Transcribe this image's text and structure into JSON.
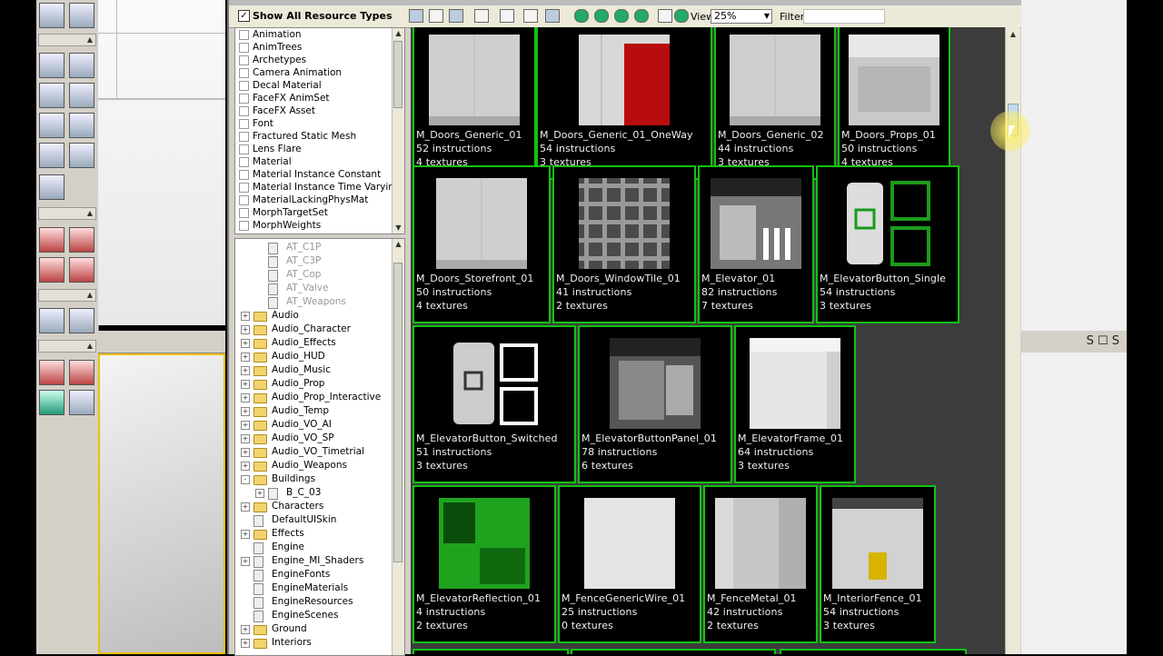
{
  "browser": {
    "show_all_label": "Show All Resource Types",
    "show_all_checked": true,
    "view_label": "View",
    "view_value": "25%",
    "filter_label": "Filter",
    "filter_value": ""
  },
  "resource_types": [
    "Animation",
    "AnimTrees",
    "Archetypes",
    "Camera Animation",
    "Decal Material",
    "FaceFX AnimSet",
    "FaceFX Asset",
    "Font",
    "Fractured Static Mesh",
    "Lens Flare",
    "Material",
    "Material Instance Constant",
    "Material Instance Time Varying",
    "MaterialLackingPhysMat",
    "MorphTargetSet",
    "MorphWeights"
  ],
  "package_tree": [
    {
      "label": "AT_C1P",
      "kind": "pkg",
      "indent": 1,
      "grey": true
    },
    {
      "label": "AT_C3P",
      "kind": "pkg",
      "indent": 1,
      "grey": true
    },
    {
      "label": "AT_Cop",
      "kind": "pkg",
      "indent": 1,
      "grey": true
    },
    {
      "label": "AT_Valve",
      "kind": "pkg",
      "indent": 1,
      "grey": true
    },
    {
      "label": "AT_Weapons",
      "kind": "pkg",
      "indent": 1,
      "grey": true
    },
    {
      "label": "Audio",
      "kind": "folder",
      "indent": 0,
      "toggle": "+"
    },
    {
      "label": "Audio_Character",
      "kind": "folder",
      "indent": 0,
      "toggle": "+"
    },
    {
      "label": "Audio_Effects",
      "kind": "folder",
      "indent": 0,
      "toggle": "+"
    },
    {
      "label": "Audio_HUD",
      "kind": "folder",
      "indent": 0,
      "toggle": "+"
    },
    {
      "label": "Audio_Music",
      "kind": "folder",
      "indent": 0,
      "toggle": "+"
    },
    {
      "label": "Audio_Prop",
      "kind": "folder",
      "indent": 0,
      "toggle": "+"
    },
    {
      "label": "Audio_Prop_Interactive",
      "kind": "folder",
      "indent": 0,
      "toggle": "+"
    },
    {
      "label": "Audio_Temp",
      "kind": "folder",
      "indent": 0,
      "toggle": "+"
    },
    {
      "label": "Audio_VO_AI",
      "kind": "folder",
      "indent": 0,
      "toggle": "+"
    },
    {
      "label": "Audio_VO_SP",
      "kind": "folder",
      "indent": 0,
      "toggle": "+"
    },
    {
      "label": "Audio_VO_Timetrial",
      "kind": "folder",
      "indent": 0,
      "toggle": "+"
    },
    {
      "label": "Audio_Weapons",
      "kind": "folder",
      "indent": 0,
      "toggle": "+"
    },
    {
      "label": "Buildings",
      "kind": "folder",
      "indent": 0,
      "toggle": "-"
    },
    {
      "label": "B_C_03",
      "kind": "pkg",
      "indent": 1,
      "toggle": "+"
    },
    {
      "label": "Characters",
      "kind": "folder",
      "indent": 0,
      "toggle": "+"
    },
    {
      "label": "DefaultUISkin",
      "kind": "pkg",
      "indent": 0
    },
    {
      "label": "Effects",
      "kind": "folder",
      "indent": 0,
      "toggle": "+"
    },
    {
      "label": "Engine",
      "kind": "pkg",
      "indent": 0
    },
    {
      "label": "Engine_MI_Shaders",
      "kind": "pkg",
      "indent": 0,
      "toggle": "+"
    },
    {
      "label": "EngineFonts",
      "kind": "pkg",
      "indent": 0
    },
    {
      "label": "EngineMaterials",
      "kind": "pkg",
      "indent": 0
    },
    {
      "label": "EngineResources",
      "kind": "pkg",
      "indent": 0
    },
    {
      "label": "EngineScenes",
      "kind": "pkg",
      "indent": 0
    },
    {
      "label": "Ground",
      "kind": "folder",
      "indent": 0,
      "toggle": "+"
    },
    {
      "label": "Interiors",
      "kind": "folder",
      "indent": 0,
      "toggle": "+"
    }
  ],
  "assets": [
    {
      "name": "M_Doors_Generic_01",
      "instructions": "52 instructions",
      "textures": "4 textures",
      "thumb": "door"
    },
    {
      "name": "M_Doors_Generic_01_OneWay",
      "instructions": "54 instructions",
      "textures": "3 textures",
      "thumb": "door-red"
    },
    {
      "name": "M_Doors_Generic_02",
      "instructions": "44 instructions",
      "textures": "3 textures",
      "thumb": "door"
    },
    {
      "name": "M_Doors_Props_01",
      "instructions": "50 instructions",
      "textures": "4 textures",
      "thumb": "props"
    },
    {
      "name": "M_Doors_Storefront_01",
      "instructions": "50 instructions",
      "textures": "4 textures",
      "thumb": "door"
    },
    {
      "name": "M_Doors_WindowTile_01",
      "instructions": "41 instructions",
      "textures": "2 textures",
      "thumb": "window"
    },
    {
      "name": "M_Elevator_01",
      "instructions": "82 instructions",
      "textures": "7 textures",
      "thumb": "elevator"
    },
    {
      "name": "M_ElevatorButton_Single",
      "instructions": "54 instructions",
      "textures": "3 textures",
      "thumb": "button-green"
    },
    {
      "name": "M_ElevatorButton_Switched",
      "instructions": "51 instructions",
      "textures": "3 textures",
      "thumb": "button-white"
    },
    {
      "name": "M_ElevatorButtonPanel_01",
      "instructions": "78 instructions",
      "textures": "6 textures",
      "thumb": "panel"
    },
    {
      "name": "M_ElevatorFrame_01",
      "instructions": "64 instructions",
      "textures": "3 textures",
      "thumb": "frame"
    },
    {
      "name": "M_ElevatorReflection_01",
      "instructions": "4 instructions",
      "textures": "2 textures",
      "thumb": "reflection"
    },
    {
      "name": "M_FenceGenericWire_01",
      "instructions": "25 instructions",
      "textures": "0 textures",
      "thumb": "plain"
    },
    {
      "name": "M_FenceMetal_01",
      "instructions": "42 instructions",
      "textures": "2 textures",
      "thumb": "metal"
    },
    {
      "name": "M_InteriorFence_01",
      "instructions": "54 instructions",
      "textures": "3 textures",
      "thumb": "fence"
    }
  ],
  "right_viewport_bar": "S ☐ S",
  "colors": {
    "tile_border": "#11c311",
    "grid_bg": "#3c3c3c",
    "selection": "#f0c000"
  }
}
